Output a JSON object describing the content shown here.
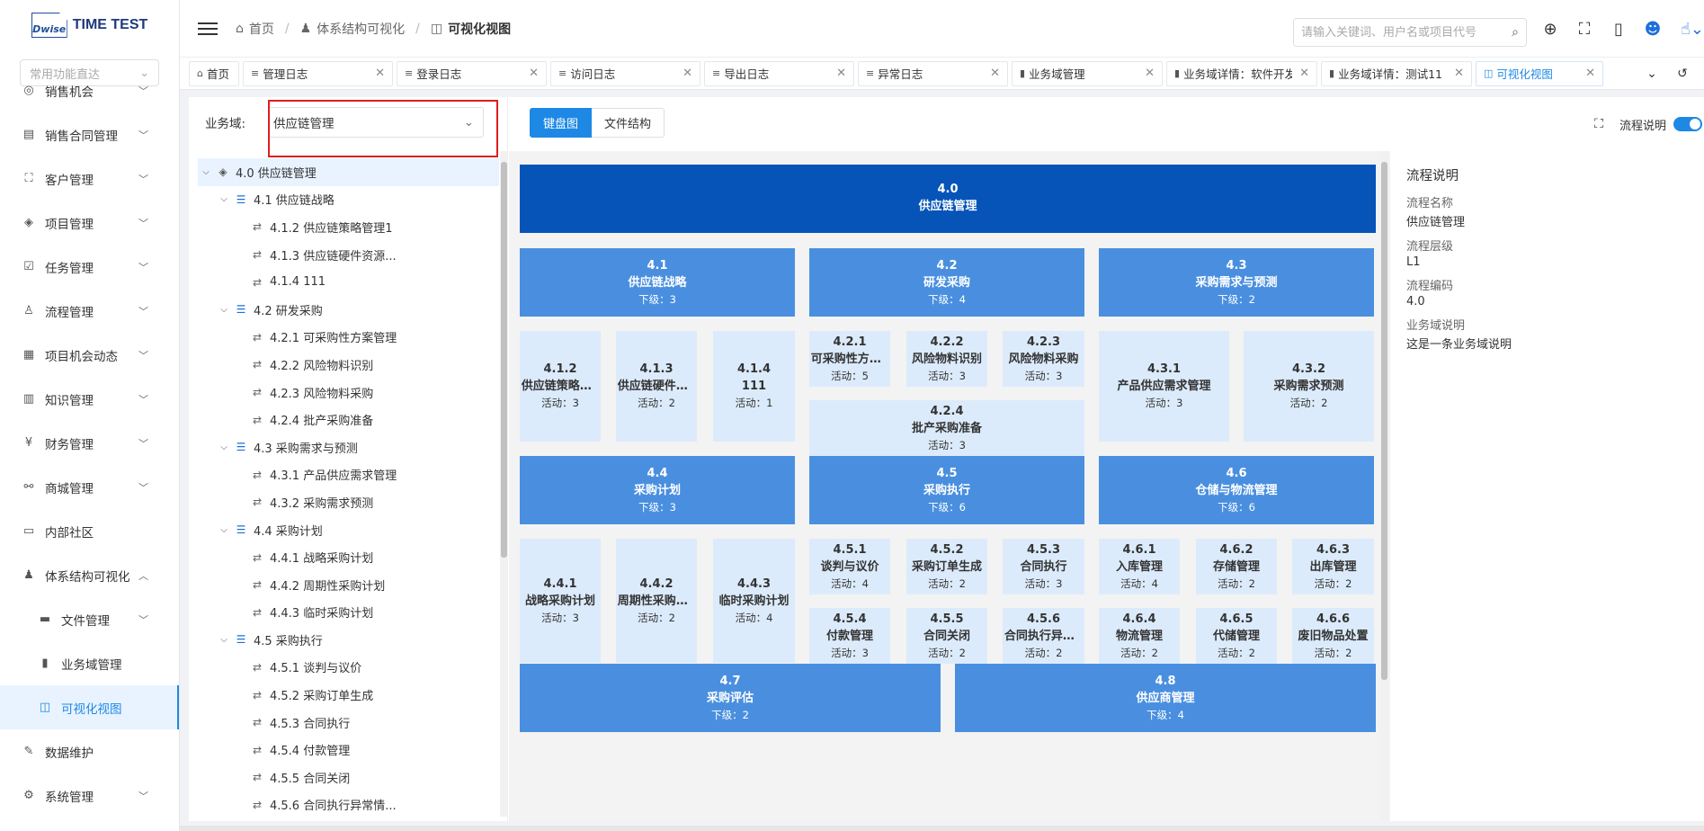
{
  "logo": {
    "mark": "Dwise",
    "text": "TIME TEST"
  },
  "quick_search": {
    "placeholder": "常用功能直达"
  },
  "nav": {
    "items": [
      {
        "label": "销售机会",
        "icon": "target-icon"
      },
      {
        "label": "销售合同管理",
        "icon": "doc-icon"
      },
      {
        "label": "客户管理",
        "icon": "crop-icon"
      },
      {
        "label": "项目管理",
        "icon": "layers-icon"
      },
      {
        "label": "任务管理",
        "icon": "check-icon"
      },
      {
        "label": "流程管理",
        "icon": "user-icon"
      },
      {
        "label": "项目机会动态",
        "icon": "calendar-icon"
      },
      {
        "label": "知识管理",
        "icon": "book-icon"
      },
      {
        "label": "财务管理",
        "icon": "yen-icon"
      },
      {
        "label": "商城管理",
        "icon": "shop-icon"
      },
      {
        "label": "内部社区",
        "icon": "chat-icon"
      },
      {
        "label": "体系结构可视化",
        "icon": "people-icon"
      }
    ],
    "sub_items": [
      {
        "label": "文件管理"
      },
      {
        "label": "业务域管理"
      },
      {
        "label": "可视化视图"
      }
    ],
    "tail_items": [
      {
        "label": "数据维护"
      },
      {
        "label": "系统管理"
      }
    ]
  },
  "breadcrumb": {
    "home": "首页",
    "parent": "体系结构可视化",
    "current": "可视化视图"
  },
  "search": {
    "placeholder": "请输入关键词、用户名或项目代号"
  },
  "tabs": [
    {
      "label": "首页",
      "closable": false
    },
    {
      "label": "管理日志",
      "closable": true
    },
    {
      "label": "登录日志",
      "closable": true
    },
    {
      "label": "访问日志",
      "closable": true
    },
    {
      "label": "导出日志",
      "closable": true
    },
    {
      "label": "异常日志",
      "closable": true
    },
    {
      "label": "业务域管理",
      "closable": true
    },
    {
      "label": "业务域详情：软件开发",
      "closable": true
    },
    {
      "label": "业务域详情：测试11",
      "closable": true
    },
    {
      "label": "可视化视图",
      "closable": true,
      "active": true
    }
  ],
  "filter": {
    "label": "业务域:",
    "value": "供应链管理"
  },
  "tree": [
    {
      "level": 0,
      "label": "4.0 供应链管理"
    },
    {
      "level": 1,
      "label": "4.1 供应链战略"
    },
    {
      "level": 2,
      "label": "4.1.2 供应链策略管理1"
    },
    {
      "level": 2,
      "label": "4.1.3 供应链硬件资源..."
    },
    {
      "level": 2,
      "label": "4.1.4 111"
    },
    {
      "level": 1,
      "label": "4.2 研发采购"
    },
    {
      "level": 2,
      "label": "4.2.1 可采购性方案管理"
    },
    {
      "level": 2,
      "label": "4.2.2 风险物料识别"
    },
    {
      "level": 2,
      "label": "4.2.3 风险物料采购"
    },
    {
      "level": 2,
      "label": "4.2.4 批产采购准备"
    },
    {
      "level": 1,
      "label": "4.3 采购需求与预测"
    },
    {
      "level": 2,
      "label": "4.3.1 产品供应需求管理"
    },
    {
      "level": 2,
      "label": "4.3.2 采购需求预测"
    },
    {
      "level": 1,
      "label": "4.4 采购计划"
    },
    {
      "level": 2,
      "label": "4.4.1 战略采购计划"
    },
    {
      "level": 2,
      "label": "4.4.2 周期性采购计划"
    },
    {
      "level": 2,
      "label": "4.4.3 临时采购计划"
    },
    {
      "level": 1,
      "label": "4.5 采购执行"
    },
    {
      "level": 2,
      "label": "4.5.1 谈判与议价"
    },
    {
      "level": 2,
      "label": "4.5.2 采购订单生成"
    },
    {
      "level": 2,
      "label": "4.5.3 合同执行"
    },
    {
      "level": 2,
      "label": "4.5.4 付款管理"
    },
    {
      "level": 2,
      "label": "4.5.5 合同关闭"
    },
    {
      "level": 2,
      "label": "4.5.6 合同执行异常情..."
    }
  ],
  "view_toggle": {
    "board": "键盘图",
    "files": "文件结构"
  },
  "board": {
    "root": {
      "code": "4.0",
      "name": "供应链管理"
    },
    "l1_prefix": "下级：",
    "l2_prefix": "活动：",
    "groups": [
      {
        "code": "4.1",
        "name": "供应链战略",
        "count": "3"
      },
      {
        "code": "4.2",
        "name": "研发采购",
        "count": "4"
      },
      {
        "code": "4.3",
        "name": "采购需求与预测",
        "count": "2"
      },
      {
        "code": "4.4",
        "name": "采购计划",
        "count": "3"
      },
      {
        "code": "4.5",
        "name": "采购执行",
        "count": "6"
      },
      {
        "code": "4.6",
        "name": "仓储与物流管理",
        "count": "6"
      },
      {
        "code": "4.7",
        "name": "采购评估",
        "count": "2"
      },
      {
        "code": "4.8",
        "name": "供应商管理",
        "count": "4"
      }
    ],
    "leaves": [
      {
        "code": "4.1.2",
        "name": "供应链策略管理1",
        "count": "3"
      },
      {
        "code": "4.1.3",
        "name": "供应链硬件资源",
        "count": "2"
      },
      {
        "code": "4.1.4",
        "name": "111",
        "count": "1"
      },
      {
        "code": "4.2.1",
        "name": "可采购性方案管理",
        "count": "5"
      },
      {
        "code": "4.2.2",
        "name": "风险物料识别",
        "count": "3"
      },
      {
        "code": "4.2.3",
        "name": "风险物料采购",
        "count": "3"
      },
      {
        "code": "4.2.4",
        "name": "批产采购准备",
        "count": "3"
      },
      {
        "code": "4.3.1",
        "name": "产品供应需求管理",
        "count": "3"
      },
      {
        "code": "4.3.2",
        "name": "采购需求预测",
        "count": "2"
      },
      {
        "code": "4.4.1",
        "name": "战略采购计划",
        "count": "3"
      },
      {
        "code": "4.4.2",
        "name": "周期性采购计划",
        "count": "2"
      },
      {
        "code": "4.4.3",
        "name": "临时采购计划",
        "count": "4"
      },
      {
        "code": "4.5.1",
        "name": "谈判与议价",
        "count": "4"
      },
      {
        "code": "4.5.2",
        "name": "采购订单生成",
        "count": "2"
      },
      {
        "code": "4.5.3",
        "name": "合同执行",
        "count": "3"
      },
      {
        "code": "4.5.4",
        "name": "付款管理",
        "count": "3"
      },
      {
        "code": "4.5.5",
        "name": "合同关闭",
        "count": "2"
      },
      {
        "code": "4.5.6",
        "name": "合同执行异常情况",
        "count": "2"
      },
      {
        "code": "4.6.1",
        "name": "入库管理",
        "count": "4"
      },
      {
        "code": "4.6.2",
        "name": "存储管理",
        "count": "2"
      },
      {
        "code": "4.6.3",
        "name": "出库管理",
        "count": "2"
      },
      {
        "code": "4.6.4",
        "name": "物流管理",
        "count": "2"
      },
      {
        "code": "4.6.5",
        "name": "代储管理",
        "count": "2"
      },
      {
        "code": "4.6.6",
        "name": "废旧物品处置",
        "count": "2"
      }
    ]
  },
  "right_panel": {
    "toggle_label": "流程说明",
    "title": "流程说明",
    "fields": [
      {
        "key": "流程名称",
        "value": "供应链管理"
      },
      {
        "key": "流程层级",
        "value": "L1"
      },
      {
        "key": "流程编码",
        "value": "4.0"
      },
      {
        "key": "业务域说明",
        "value": "这是一条业务域说明"
      }
    ]
  },
  "colors": {
    "primary": "#1e88e5",
    "root_box": "#0654b8",
    "group_box": "#4a8fdf",
    "leaf_box": "#dcebfb",
    "highlight": "#e11d1d"
  }
}
